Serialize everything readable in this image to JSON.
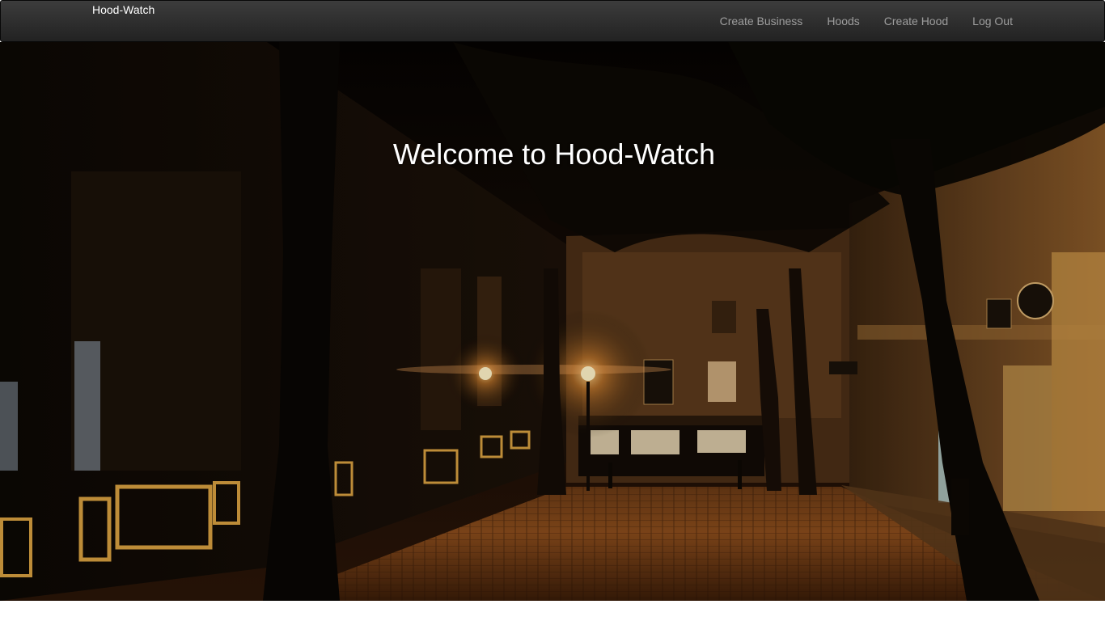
{
  "navbar": {
    "brand": "Hood-Watch",
    "links": [
      {
        "label": "Create Business"
      },
      {
        "label": "Hoods"
      },
      {
        "label": "Create Hood"
      },
      {
        "label": "Log Out"
      }
    ]
  },
  "hero": {
    "title": "Welcome to Hood-Watch",
    "image": "night-street-photo"
  },
  "colors": {
    "navbar_bg": "#222222",
    "nav_link": "#9d9d9d",
    "brand": "#ffffff",
    "title": "#ffffff"
  }
}
